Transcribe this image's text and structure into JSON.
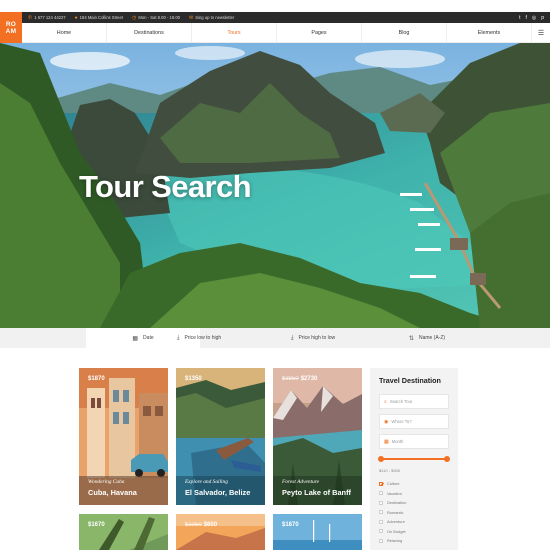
{
  "brand": {
    "logo_line1": "RO",
    "logo_line2": "AM",
    "color": "#f36f21"
  },
  "topbar": {
    "phone": "1 677 124 44227",
    "address": "184 Main Collins Street",
    "hours": "Mon - Sat 8.00 - 18.00",
    "newsletter": "Sing up to newsletter",
    "social_icons": [
      "twitter-icon",
      "facebook-icon",
      "instagram-icon",
      "pinterest-icon"
    ]
  },
  "nav": {
    "items": [
      {
        "label": "Home"
      },
      {
        "label": "Destinations"
      },
      {
        "label": "Tours"
      },
      {
        "label": "Pages"
      },
      {
        "label": "Blog"
      },
      {
        "label": "Elements"
      }
    ],
    "active_index": 2
  },
  "hero": {
    "title": "Tour Search"
  },
  "sort": {
    "tabs": [
      {
        "label": "Date",
        "icon": "calendar-icon"
      },
      {
        "label": "Price low to high",
        "icon": "sort-down-icon"
      },
      {
        "label": "Price high to low",
        "icon": "sort-down-icon"
      },
      {
        "label": "Name (A-Z)",
        "icon": "sort-alpha-icon"
      }
    ],
    "active_index": 0
  },
  "tours": [
    {
      "price": "$1870",
      "old_price": "",
      "subtitle": "Wondering Cuba",
      "title": "Cuba, Havana"
    },
    {
      "price": "$1350",
      "old_price": "",
      "subtitle": "Explore and Sailing",
      "title": "El Salvador, Belize"
    },
    {
      "price": "$2730",
      "old_price": "$3850",
      "subtitle": "Forest Adventure",
      "title": "Peyto Lake of Banff"
    },
    {
      "price": "$1670",
      "old_price": "",
      "subtitle": "",
      "title": ""
    },
    {
      "price": "$600",
      "old_price": "$1050",
      "subtitle": "",
      "title": ""
    },
    {
      "price": "$1870",
      "old_price": "",
      "subtitle": "",
      "title": ""
    }
  ],
  "sidebar": {
    "title": "Travel Destination",
    "search_placeholder": "Search Tour",
    "where_placeholder": "Where To?",
    "month_placeholder": "Month",
    "price_range": "$110 - $300",
    "categories": [
      {
        "label": "Culture",
        "checked": true
      },
      {
        "label": "Vacation",
        "checked": false
      },
      {
        "label": "Destination",
        "checked": false
      },
      {
        "label": "Romantic",
        "checked": false
      },
      {
        "label": "Adventure",
        "checked": false
      },
      {
        "label": "On Budget",
        "checked": false
      },
      {
        "label": "Relaxing",
        "checked": false
      }
    ]
  }
}
